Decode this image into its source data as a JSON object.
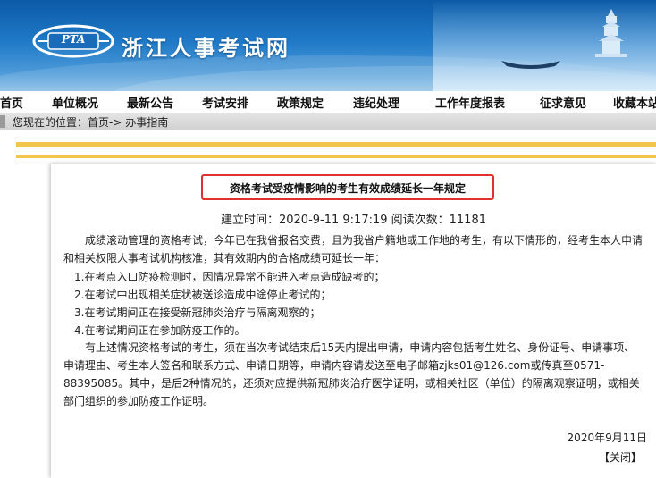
{
  "header": {
    "logo_text": "PTA",
    "site_name": "浙江人事考试网"
  },
  "nav": {
    "items": [
      "首页",
      "单位概况",
      "最新公告",
      "考试安排",
      "政策规定",
      "违纪处理",
      "工作年度报表",
      "征求意见",
      "收藏本站"
    ]
  },
  "breadcrumb": {
    "text": "您现在的位置：首页-> 办事指南"
  },
  "article": {
    "title": "资格考试受疫情影响的考生有效成绩延长一年规定",
    "meta": "建立时间：2020-9-11 9:17:19 阅读次数：11181",
    "intro": "成绩滚动管理的资格考试，今年已在我省报名交费，且为我省户籍地或工作地的考生，有以下情形的，经考生本人申请和相关权限人事考试机构核准，其有效期内的合格成绩可延长一年：",
    "items": [
      "1.在考点入口防疫检测时，因情况异常不能进入考点造成缺考的；",
      "2.在考试中出现相关症状被送诊造成中途停止考试的；",
      "3.在考试期间正在接受新冠肺炎治疗与隔离观察的；",
      "4.在考试期间正在参加防疫工作的。"
    ],
    "body": "有上述情况资格考试的考生，须在当次考试结束后15天内提出申请，申请内容包括考生姓名、身份证号、申请事项、申请理由、考生本人签名和联系方式、申请日期等，申请内容请发送至电子邮箱zjks01@126.com或传真至0571-88395085。其中，是后2种情况的，还须对应提供新冠肺炎治疗医学证明，或相关社区（单位）的隔离观察证明，或相关部门组织的参加防疫工作证明。",
    "date": "2020年9月11日",
    "close_label": "【关闭】"
  },
  "colors": {
    "banner_blue": "#1f79c7",
    "gold_bar": "#f2c64c",
    "title_border": "#e03030"
  }
}
